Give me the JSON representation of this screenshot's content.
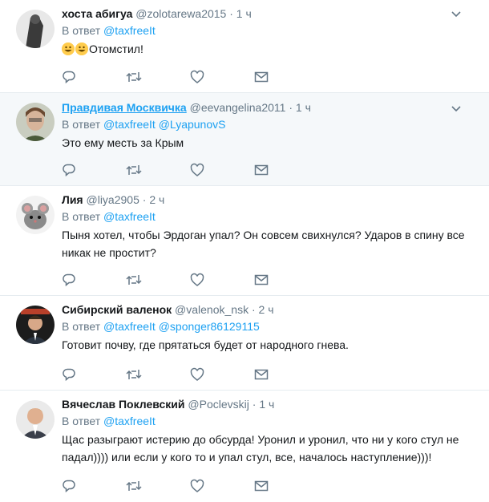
{
  "reply_prefix": "В ответ",
  "dot": "·",
  "tweets": [
    {
      "name": "хоста абигуа",
      "handle": "@zolotarewa2015",
      "time": "1 ч",
      "mentions": [
        "@taxfreeIt"
      ],
      "text_lines": [
        "Отомстил!"
      ],
      "emoji": [
        "grinning-face-icon",
        "grinning-face-icon"
      ]
    },
    {
      "name": "Правдивая Москвичка",
      "handle": "@eevangelina2011",
      "time": "1 ч",
      "mentions": [
        "@taxfreeIt",
        "@LyapunovS"
      ],
      "text_lines": [
        "Это ему месть за Крым"
      ]
    },
    {
      "name": "Лия",
      "handle": "@liya2905",
      "time": "2 ч",
      "mentions": [
        "@taxfreeIt"
      ],
      "text_lines": [
        "Пыня хотел, чтобы Эрдоган упал? Он совсем свихнулся? Ударов в спину все",
        "никак не простит?"
      ]
    },
    {
      "name": "Сибирский валенок",
      "handle": "@valenok_nsk",
      "time": "2 ч",
      "mentions": [
        "@taxfreeIt",
        "@sponger86129115"
      ],
      "text_lines": [
        "Готовит почву, где прятаться будет от народного гнева."
      ]
    },
    {
      "name": "Вячеслав Поклевский",
      "handle": "@Poclevskij",
      "time": "1 ч",
      "mentions": [
        "@taxfreeIt"
      ],
      "text_lines": [
        "Щас разыграют истерию до обсурда! Уронил и уронил, что ни у кого стул не",
        "падал)))) или если у кого то и упал стул, все, началось наступление)))!"
      ]
    }
  ],
  "colors": {
    "accent": "#1da1f2",
    "muted": "#657786",
    "border": "#e6ecf0",
    "highlight_bg": "#f5f8fa"
  }
}
